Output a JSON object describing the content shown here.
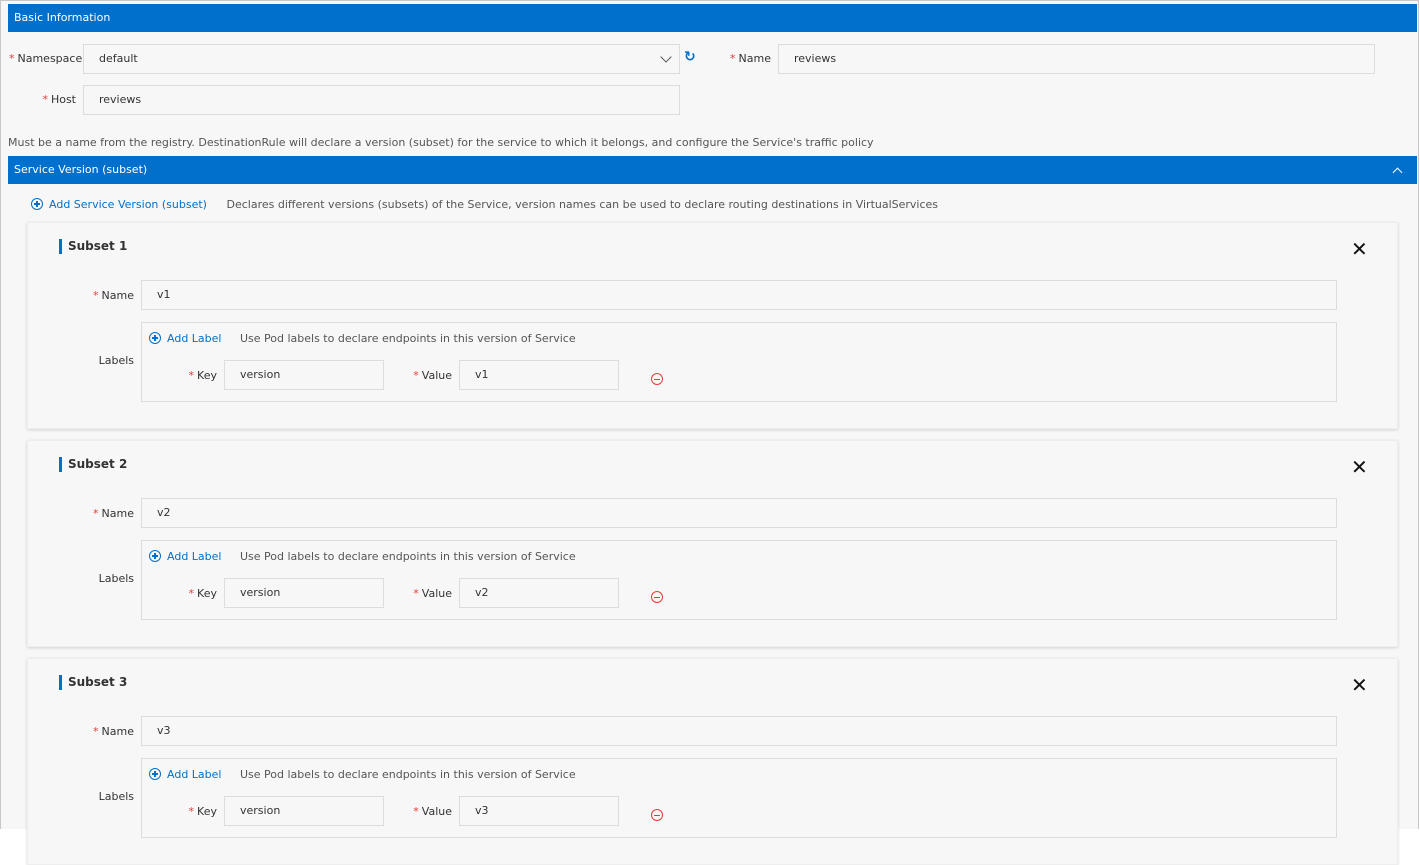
{
  "basic": {
    "title": "Basic Information",
    "namespace_label": "Namespace",
    "namespace_value": "default",
    "name_label": "Name",
    "name_value": "reviews",
    "host_label": "Host",
    "host_value": "reviews",
    "help": "Must be a name from the registry. DestinationRule will declare a version (subset) for the service to which it belongs, and configure the Service's traffic policy"
  },
  "service": {
    "title": "Service Version (subset)",
    "add_label": "Add Service Version (subset)",
    "add_help": "Declares different versions (subsets) of the Service, version names can be used to declare routing destinations in VirtualServices"
  },
  "subsets": [
    {
      "title": "Subset 1",
      "name_label": "Name",
      "name": "v1",
      "labels_label": "Labels",
      "add_label": "Add Label",
      "add_help": "Use Pod labels to declare endpoints in this version of Service",
      "key_label": "Key",
      "key": "version",
      "value_label": "Value",
      "value": "v1"
    },
    {
      "title": "Subset 2",
      "name_label": "Name",
      "name": "v2",
      "labels_label": "Labels",
      "add_label": "Add Label",
      "add_help": "Use Pod labels to declare endpoints in this version of Service",
      "key_label": "Key",
      "key": "version",
      "value_label": "Value",
      "value": "v2"
    },
    {
      "title": "Subset 3",
      "name_label": "Name",
      "name": "v3",
      "labels_label": "Labels",
      "add_label": "Add Label",
      "add_help": "Use Pod labels to declare endpoints in this version of Service",
      "key_label": "Key",
      "key": "version",
      "value_label": "Value",
      "value": "v3"
    }
  ],
  "colors": {
    "accent": "#0070cc",
    "required": "#e23c39"
  }
}
